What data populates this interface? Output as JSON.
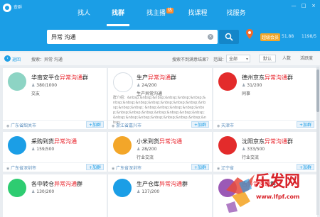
{
  "app": {
    "title": "查群"
  },
  "tabs": [
    {
      "label": "找人",
      "active": false
    },
    {
      "label": "找群",
      "active": true
    },
    {
      "label": "找主播",
      "badge": "热",
      "active": false
    },
    {
      "label": "找课程",
      "active": false
    },
    {
      "label": "找服务",
      "active": false
    }
  ],
  "window_controls": [
    "—",
    "□",
    "×"
  ],
  "search": {
    "value": "异常 沟通",
    "clear": "×"
  },
  "user": {
    "vip": "超级会员",
    "nickname": "51.88",
    "id": "1198/5"
  },
  "filter": {
    "back": "返回",
    "summary": "搜索：异常 沟通",
    "partial": "搜索不到满意结果？",
    "range_label": "范围：",
    "range_value": "全部",
    "sorts": [
      "默认",
      "人数",
      "活跃度"
    ]
  },
  "cards": [
    {
      "prefix": "华南安平仓",
      "highlight": "异常沟通",
      "suffix": "群",
      "count": "380/1000",
      "tag": "交友",
      "desc": "",
      "location": "广东省韶关市",
      "join": "+加群",
      "avatar_color": "#8dd4c4"
    },
    {
      "prefix": "生产",
      "highlight": "异常沟通",
      "suffix": "群",
      "count": "24/200",
      "tag": "生产异常沟通",
      "desc": "群介绍：&nbsp;&nbsp;&nbsp;&nbsp;&nbsp;&nbsp;&nbsp;&nbsp;&nbsp;&nbsp;&nbsp;&nbsp;&nbsp;&nbsp;&nbsp;&nbsp; &nbsp;&nbsp;&nbsp;&nbsp;&nbsp;&nbsp;&nbsp;&nbsp;&nbsp;&nbsp;&nbsp;&nbsp;&nbsp;&nbsp;&nbsp;&nbsp;&nbsp;&nbsp;&nbsp;&nbsp;",
      "location": "浙江省嘉兴市",
      "join": "+加群",
      "avatar_color": "#ffffff"
    },
    {
      "prefix": "德州京东",
      "highlight": "异常沟通",
      "suffix": "群",
      "count": "31/200",
      "tag": "同事",
      "desc": "",
      "location": "天津市",
      "join": "+加群",
      "avatar_color": "#e32b2b"
    },
    {
      "prefix": "采购到货",
      "highlight": "异常沟通",
      "suffix": "",
      "count": "159/500",
      "tag": "",
      "desc": "",
      "location": "广东省深圳市",
      "join": "+加群",
      "avatar_color": "#1b9ee6"
    },
    {
      "prefix": "小米到货",
      "highlight": "异常沟通",
      "suffix": "",
      "count": "28/200",
      "tag": "行业交流",
      "desc": "",
      "location": "广东省深圳市",
      "join": "+加群",
      "avatar_color": "#f3a629"
    },
    {
      "prefix": "沈阳京东",
      "highlight": "异常沟通",
      "suffix": "群",
      "count": "333/500",
      "tag": "行业交流",
      "desc": "",
      "location": "辽宁省",
      "join": "+加群",
      "avatar_color": "#e32b2b"
    },
    {
      "prefix": "各中转仓",
      "highlight": "异常沟通",
      "suffix": "群",
      "count": "130/200",
      "tag": "",
      "desc": "",
      "location": "",
      "join": "",
      "avatar_color": "#2ecc71"
    },
    {
      "prefix": "生产仓库",
      "highlight": "异常沟通",
      "suffix": "群",
      "count": "137/200",
      "tag": "",
      "desc": "",
      "location": "",
      "join": "",
      "avatar_color": "#1b9ee6"
    },
    {
      "prefix": "吉",
      "highlight": "异常沟通",
      "suffix": "群",
      "count": "",
      "tag": "",
      "desc": "",
      "location": "",
      "join": "",
      "avatar_color": "#9b59b6"
    }
  ],
  "watermark": {
    "text": "乐发网",
    "url": "www.lfpf.com"
  }
}
